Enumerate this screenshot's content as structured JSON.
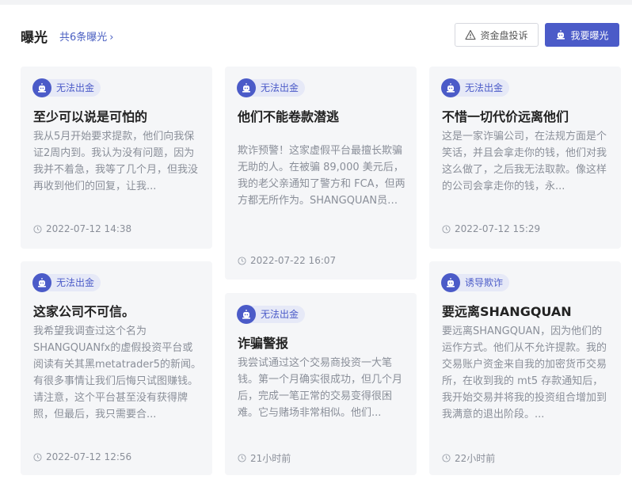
{
  "header": {
    "title": "曝光",
    "count_link": "共6条曝光",
    "complaint_button": "资金盘投诉",
    "expose_button": "我要曝光"
  },
  "cards": [
    {
      "tag": "无法出金",
      "title": "至少可以说是可怕的",
      "body": "我从5月开始要求提款，他们向我保证2周内到。我认为没有问题，因为我并不着急，我等了几个月，但我没再收到他们的回复，让我...",
      "time": "2022-07-12 14:38"
    },
    {
      "tag": "无法出金",
      "title": "他们不能卷款潜逃",
      "body": "欺诈预警！这家虚假平台最擅长欺骗无助的人。在被骗 89,000 美元后，我的老父亲通知了警方和 FCA，但两方都无所作为。SHANGQUAN员工很擅长劝说...",
      "time": "2022-07-22 16:07"
    },
    {
      "tag": "无法出金",
      "title": "不惜一切代价远离他们",
      "body": "这是一家诈骗公司，在法规方面是个笑话，并且会拿走你的钱，他们对我这么做了，之后我无法取款。像这样的公司会拿走你的钱，永...",
      "time": "2022-07-12 15:29"
    },
    {
      "tag": "无法出金",
      "title": "这家公司不可信。",
      "body": "我希望我调查过这个名为SHANGQUANfx的虚假投资平台或阅读有关其黑metatrader5的新闻。有很多事情让我们后悔只试图赚钱。请注意，这个平台甚至没有获得牌照，但最后，我只需要合...",
      "time": "2022-07-12 12:56"
    },
    {
      "tag": "无法出金",
      "title": "诈骗警报",
      "body": "我尝试通过这个交易商投资一大笔钱。第一个月确实很成功，但几个月后，完成一笔正常的交易变得很困难。它与赌场非常相似。他们...",
      "time": "21小时前"
    },
    {
      "tag": "诱导欺诈",
      "title": "要远离SHANGQUAN",
      "body": "要远离SHANGQUAN，因为他们的运作方式。他们从不允许提款。我的交易账户资金来自我的加密货币交易所，在收到我的 mt5 存款通知后，我开始交易并将我的投资组合增加到我满意的退出阶段。...",
      "time": "22小时前"
    }
  ]
}
